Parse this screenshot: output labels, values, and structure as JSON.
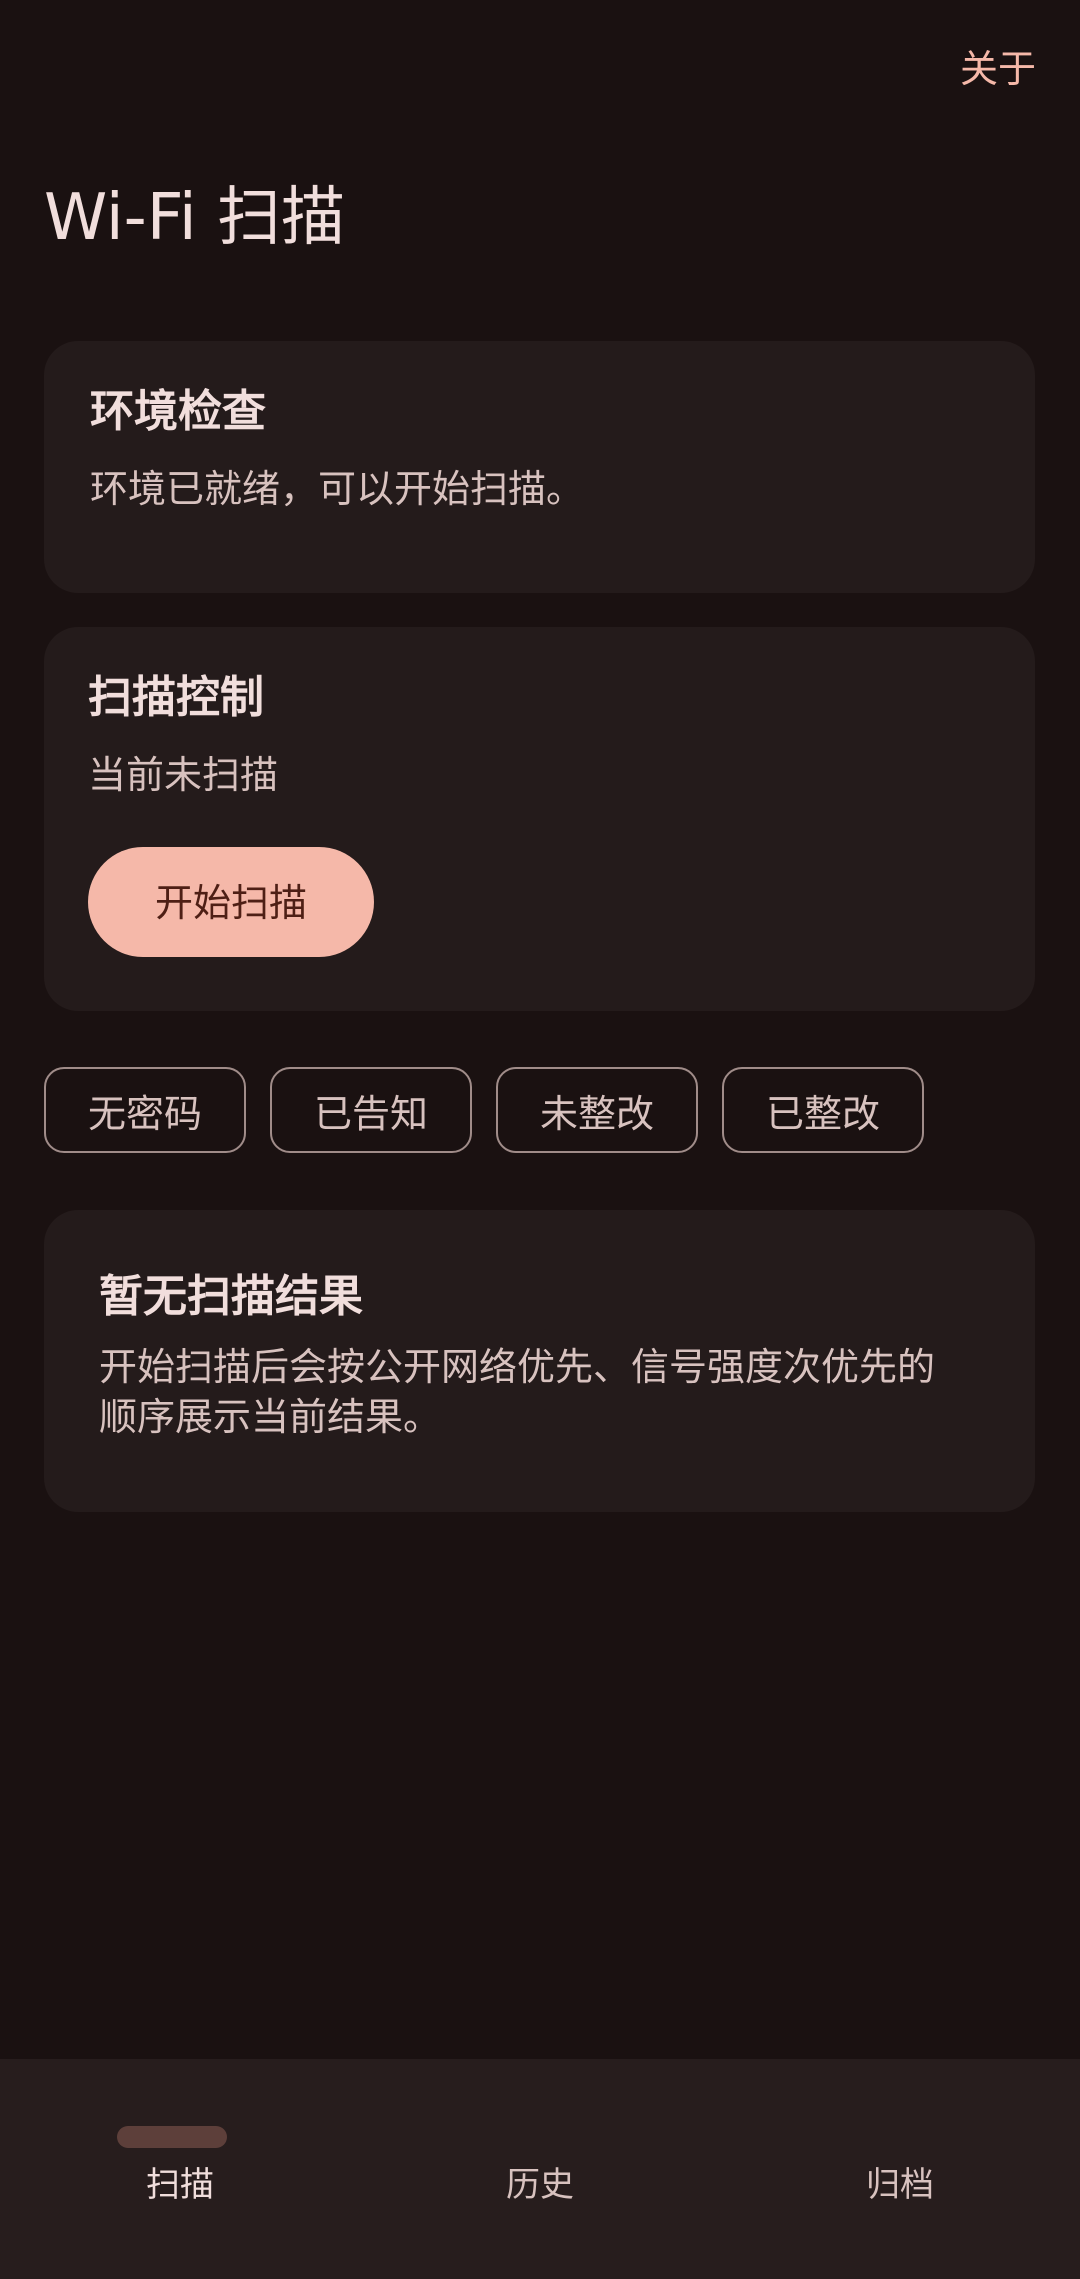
{
  "header": {
    "about_label": "关于",
    "title": "Wi-Fi 扫描"
  },
  "env_check": {
    "title": "环境检查",
    "status": "环境已就绪，可以开始扫描。"
  },
  "scan_control": {
    "title": "扫描控制",
    "status": "当前未扫描",
    "start_button_label": "开始扫描"
  },
  "filters": [
    {
      "label": "无密码"
    },
    {
      "label": "已告知"
    },
    {
      "label": "未整改"
    },
    {
      "label": "已整改"
    }
  ],
  "results": {
    "empty_title": "暂无扫描结果",
    "empty_description_line1": "开始扫描后会按公开网络优先、信号强度次优先的",
    "empty_description_line2": "顺序展示当前结果。"
  },
  "bottom_nav": {
    "items": [
      {
        "label": "扫描",
        "active": true
      },
      {
        "label": "历史",
        "active": false
      },
      {
        "label": "归档",
        "active": false
      }
    ]
  },
  "colors": {
    "background": "#1a1111",
    "surface": "#241b1b",
    "accent": "#f5b8a9",
    "on_accent": "#4e1f15",
    "text_primary": "#f1dedc",
    "text_secondary": "#d8c2bf",
    "outline": "#a08c89",
    "nav_background": "#271d1d",
    "nav_indicator": "#5d3f3a"
  }
}
